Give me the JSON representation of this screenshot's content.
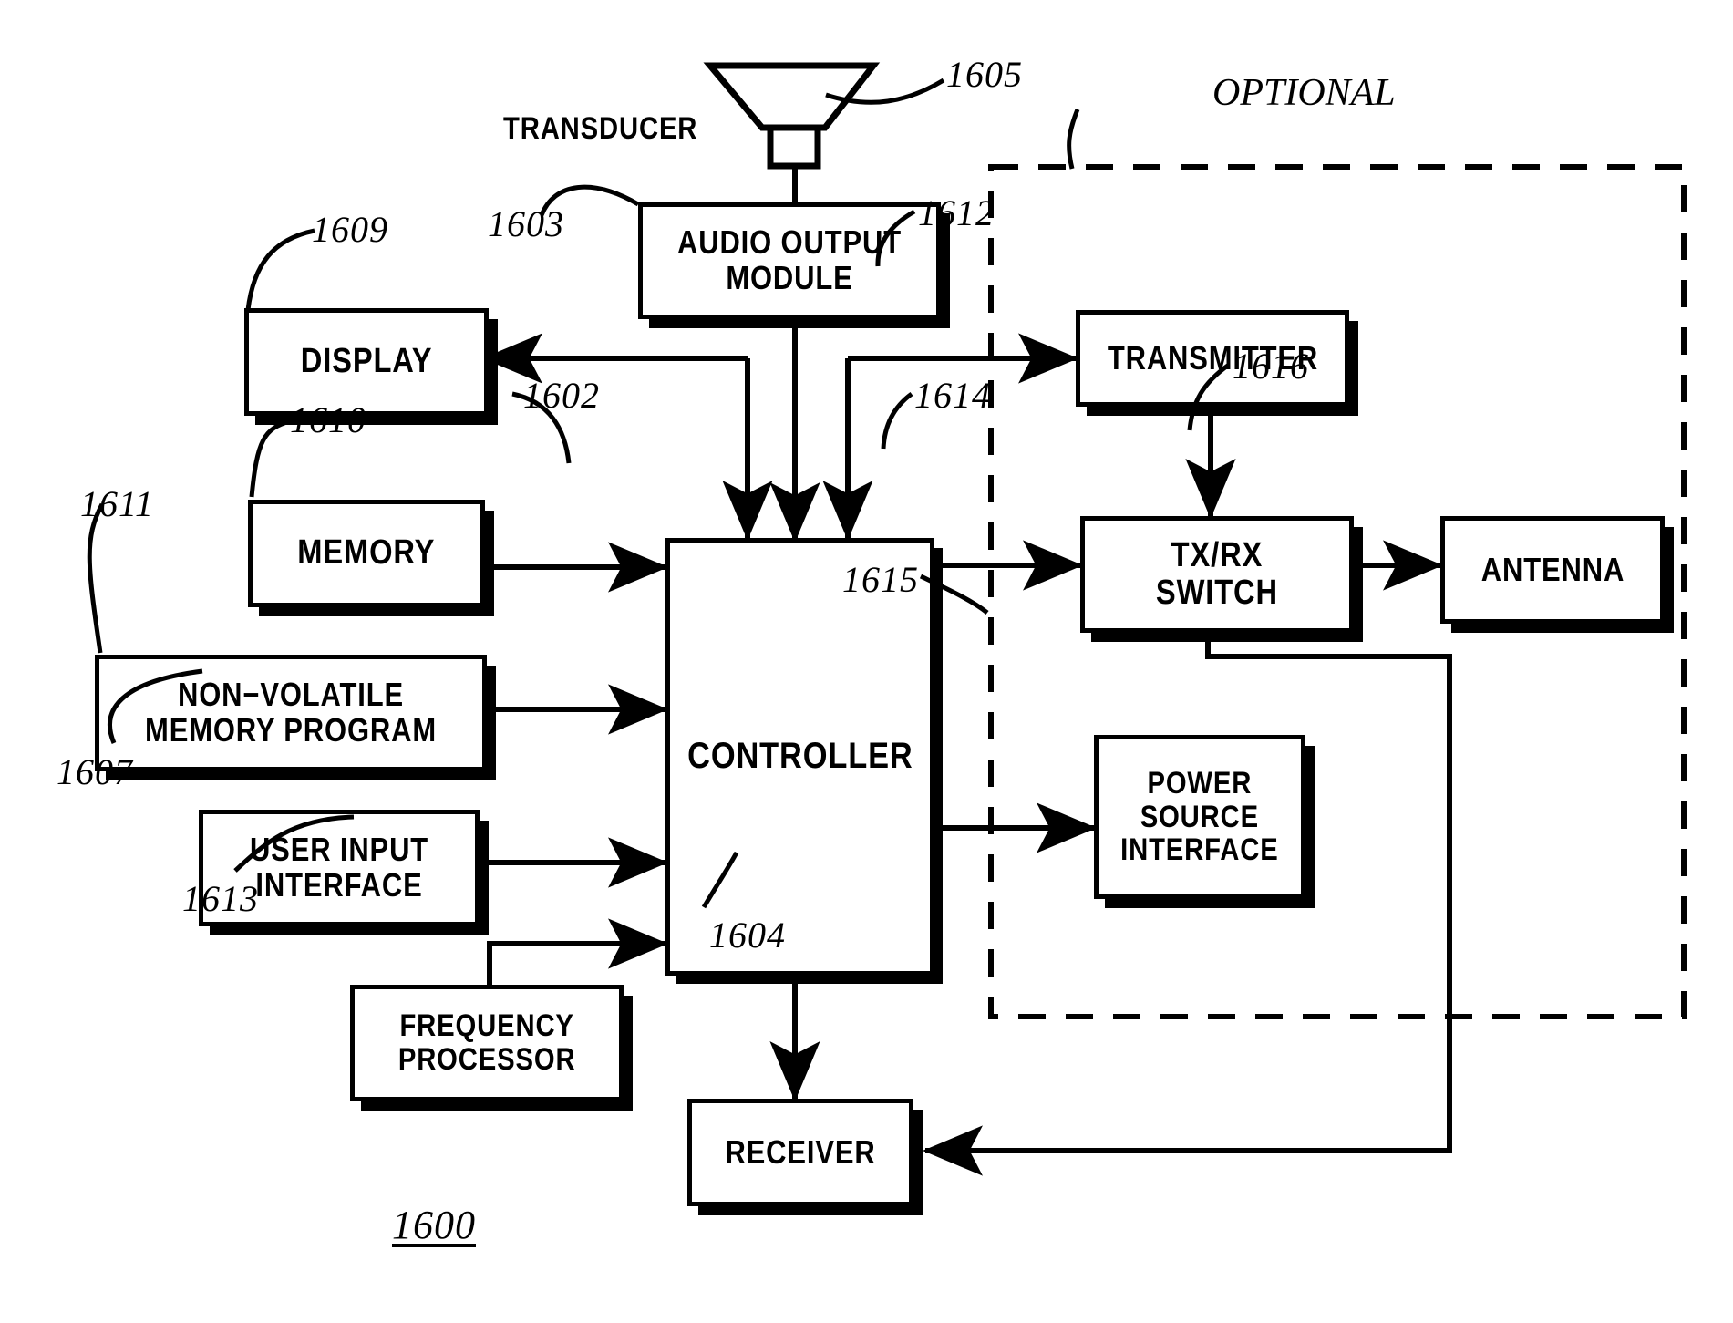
{
  "figure": {
    "figure_number": "1600",
    "optional_label": "OPTIONAL",
    "transducer_label": "TRANSDUCER"
  },
  "blocks": [
    {
      "id": "audio_output_module",
      "label": "AUDIO  OUTPUT\nMODULE",
      "ref": "1603"
    },
    {
      "id": "display",
      "label": "DISPLAY",
      "ref": "1609"
    },
    {
      "id": "memory",
      "label": "MEMORY",
      "ref": "1610"
    },
    {
      "id": "non_volatile_memory",
      "label": "NON−VOLATILE\nMEMORY  PROGRAM",
      "ref": "1611"
    },
    {
      "id": "user_input_interface",
      "label": "USER  INPUT\nINTERFACE",
      "ref": "1607"
    },
    {
      "id": "frequency_processor",
      "label": "FREQUENCY\nPROCESSOR",
      "ref": "1613"
    },
    {
      "id": "controller",
      "label": "CONTROLLER",
      "ref": "1602"
    },
    {
      "id": "receiver",
      "label": "RECEIVER",
      "ref": "1604"
    },
    {
      "id": "transmitter",
      "label": "TRANSMITTER",
      "ref": "1612"
    },
    {
      "id": "tx_rx_switch",
      "label": "TX/RX\nSWITCH",
      "ref": "1614"
    },
    {
      "id": "antenna",
      "label": "ANTENNA",
      "ref": "1616"
    },
    {
      "id": "power_source_interface",
      "label": "POWER\nSOURCE\nINTERFACE",
      "ref": "1615"
    }
  ],
  "transducer": {
    "ref": "1605",
    "label": "TRANSDUCER"
  },
  "refs": {
    "r1600": "1600",
    "r1602": "1602",
    "r1603": "1603",
    "r1604": "1604",
    "r1605": "1605",
    "r1607": "1607",
    "r1609": "1609",
    "r1610": "1610",
    "r1611": "1611",
    "r1612": "1612",
    "r1613": "1613",
    "r1614": "1614",
    "r1615": "1615",
    "r1616": "1616"
  },
  "colors": {
    "ink": "#000000",
    "paper": "#ffffff"
  }
}
